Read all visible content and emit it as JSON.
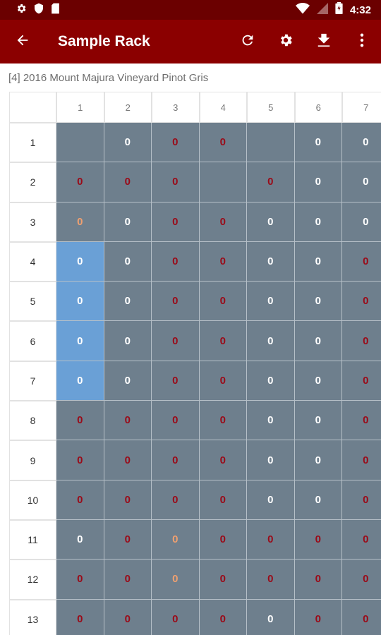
{
  "status": {
    "time": "4:32"
  },
  "app": {
    "title": "Sample Rack"
  },
  "wine_label": "[4] 2016 Mount Majura Vineyard Pinot Gris",
  "colors": {
    "white_bottle": "#ffffff",
    "red_bottle": "#9a0a18",
    "rose_bottle": "#f0a070",
    "selected_slot": "#6aa0d6",
    "slot": "#6e7f8d"
  },
  "grid": {
    "columns": [
      "1",
      "2",
      "3",
      "4",
      "5",
      "6",
      "7"
    ],
    "rows": [
      "1",
      "2",
      "3",
      "4",
      "5",
      "6",
      "7",
      "8",
      "9",
      "10",
      "11",
      "12",
      "13"
    ],
    "cells": [
      [
        "",
        "w",
        "r",
        "r",
        "",
        "w",
        "w"
      ],
      [
        "r",
        "r",
        "r",
        "",
        "r",
        "w",
        "w"
      ],
      [
        "o",
        "w",
        "r",
        "r",
        "w",
        "w",
        "w"
      ],
      [
        "w",
        "w",
        "r",
        "r",
        "w",
        "w",
        "r"
      ],
      [
        "w",
        "w",
        "r",
        "r",
        "w",
        "w",
        "r"
      ],
      [
        "w",
        "w",
        "r",
        "r",
        "w",
        "w",
        "r"
      ],
      [
        "w",
        "w",
        "r",
        "r",
        "w",
        "w",
        "r"
      ],
      [
        "r",
        "r",
        "r",
        "r",
        "w",
        "w",
        "r"
      ],
      [
        "r",
        "r",
        "r",
        "r",
        "w",
        "w",
        "r"
      ],
      [
        "r",
        "r",
        "r",
        "r",
        "w",
        "w",
        "r"
      ],
      [
        "w",
        "r",
        "o",
        "r",
        "r",
        "r",
        "r"
      ],
      [
        "r",
        "r",
        "o",
        "r",
        "r",
        "r",
        "r"
      ],
      [
        "r",
        "r",
        "r",
        "r",
        "w",
        "r",
        "r"
      ]
    ],
    "selected": [
      [
        3,
        0
      ],
      [
        4,
        0
      ],
      [
        5,
        0
      ],
      [
        6,
        0
      ]
    ],
    "bottle_glyph": "0"
  }
}
